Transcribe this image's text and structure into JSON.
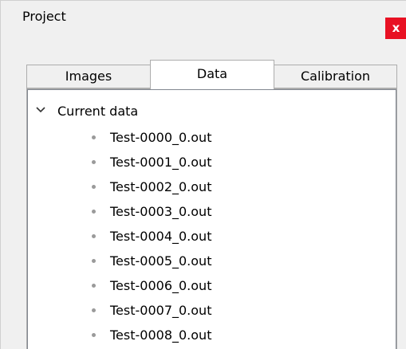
{
  "window": {
    "title": "Project",
    "close_glyph": "x"
  },
  "tabs": [
    {
      "label": "Images",
      "active": false
    },
    {
      "label": "Data",
      "active": true
    },
    {
      "label": "Calibration",
      "active": false
    }
  ],
  "tree": {
    "root_label": "Current data",
    "expanded": true,
    "expand_icon": "chevron-down-icon",
    "items": [
      "Test-0000_0.out",
      "Test-0001_0.out",
      "Test-0002_0.out",
      "Test-0003_0.out",
      "Test-0004_0.out",
      "Test-0005_0.out",
      "Test-0006_0.out",
      "Test-0007_0.out",
      "Test-0008_0.out"
    ]
  },
  "colors": {
    "close_button": "#e81123",
    "panel_background": "#f0f0f0",
    "content_background": "#ffffff",
    "bullet": "#9a9a9a"
  }
}
